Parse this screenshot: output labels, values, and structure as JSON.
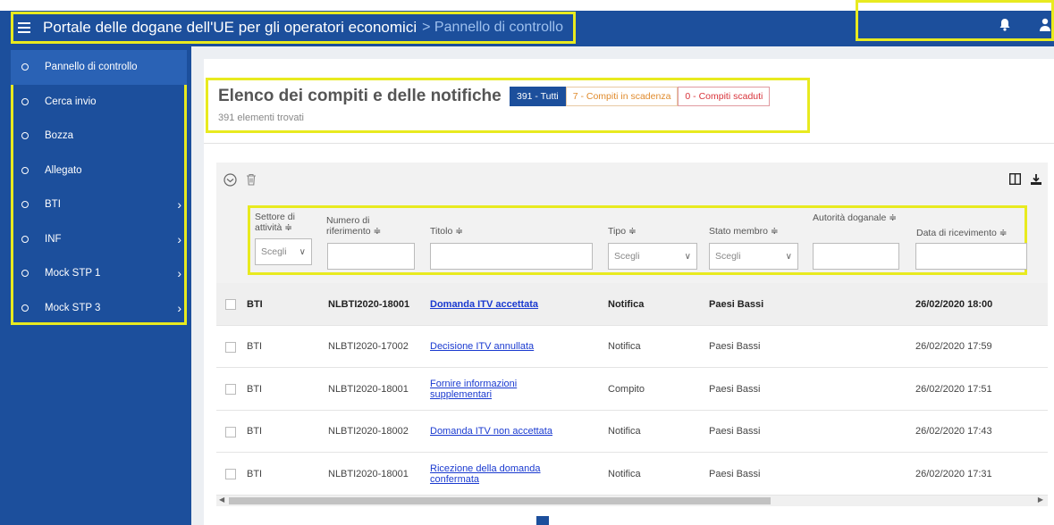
{
  "header": {
    "app_title": "Portale delle dogane dell'UE per gli operatori economici",
    "breadcrumb": "> Pannello di controllo"
  },
  "sidebar": {
    "items": [
      {
        "label": "Pannello di controllo",
        "submenu": false
      },
      {
        "label": "Cerca invio",
        "submenu": false
      },
      {
        "label": "Bozza",
        "submenu": false
      },
      {
        "label": "Allegato",
        "submenu": false
      },
      {
        "label": "BTI",
        "submenu": true
      },
      {
        "label": "INF",
        "submenu": true
      },
      {
        "label": "Mock STP 1",
        "submenu": true
      },
      {
        "label": "Mock STP 3",
        "submenu": true
      }
    ]
  },
  "main": {
    "title": "Elenco dei compiti e delle notifiche",
    "subtitle": "391 elementi trovati",
    "badges": {
      "all": "391 - Tutti",
      "due": "7 - Compiti in scadenza",
      "overdue": "0 - Compiti scaduti"
    }
  },
  "filters": {
    "sector": {
      "label": "Settore di attività ≑",
      "select": "Scegli"
    },
    "reference": {
      "label": "Numero di riferimento ≑"
    },
    "title": {
      "label": "Titolo ≑"
    },
    "type": {
      "label": "Tipo ≑",
      "select": "Scegli"
    },
    "member_state": {
      "label": "Stato membro ≑",
      "select": "Scegli"
    },
    "authority": {
      "label": "Autorità doganale ≑"
    },
    "received": {
      "label": "Data di ricevimento ≑"
    }
  },
  "rows": [
    {
      "sector": "BTI",
      "ref": "NLBTI2020-18001",
      "title": "Domanda ITV accettata",
      "type": "Notifica",
      "state": "Paesi Bassi",
      "date": "26/02/2020 18:00"
    },
    {
      "sector": "BTI",
      "ref": "NLBTI2020-17002",
      "title": "Decisione ITV annullata",
      "type": "Notifica",
      "state": "Paesi Bassi",
      "date": "26/02/2020 17:59"
    },
    {
      "sector": "BTI",
      "ref": "NLBTI2020-18001",
      "title": "Fornire informazioni supplementari",
      "type": "Compito",
      "state": "Paesi Bassi",
      "date": "26/02/2020 17:51"
    },
    {
      "sector": "BTI",
      "ref": "NLBTI2020-18002",
      "title": "Domanda ITV non accettata",
      "type": "Notifica",
      "state": "Paesi Bassi",
      "date": "26/02/2020 17:43"
    },
    {
      "sector": "BTI",
      "ref": "NLBTI2020-18001",
      "title": "Ricezione della domanda confermata",
      "type": "Notifica",
      "state": "Paesi Bassi",
      "date": "26/02/2020 17:31"
    }
  ],
  "colors": {
    "brand": "#1c4f9c",
    "highlight": "#e8ea1f",
    "link": "#1a3ad0"
  },
  "icons": [
    "menu-icon",
    "bell-icon",
    "user-icon",
    "open-icon",
    "trash-icon",
    "columns-icon",
    "download-icon"
  ]
}
